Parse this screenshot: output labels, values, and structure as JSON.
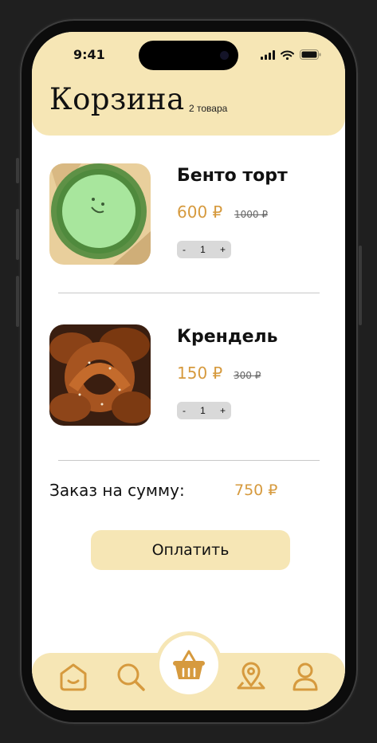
{
  "status_bar": {
    "time": "9:41"
  },
  "header": {
    "title": "Корзина",
    "count": "2 товара"
  },
  "cart": {
    "items": [
      {
        "name": "Бенто торт",
        "price": "600 ₽",
        "old_price": "1000 ₽",
        "quantity": "1",
        "minus": "-",
        "plus": "+"
      },
      {
        "name": "Крендель",
        "price": "150 ₽",
        "old_price": "300 ₽",
        "quantity": "1",
        "minus": "-",
        "plus": "+"
      }
    ]
  },
  "summary": {
    "label": "Заказ на сумму:",
    "total": "750 ₽"
  },
  "pay_button": {
    "label": "Оплатить"
  },
  "tab_bar": {
    "items": [
      {
        "icon": "home-icon",
        "active": false
      },
      {
        "icon": "search-icon",
        "active": false
      },
      {
        "icon": "basket-icon",
        "active": true
      },
      {
        "icon": "map-pin-icon",
        "active": false
      },
      {
        "icon": "profile-icon",
        "active": false
      }
    ]
  },
  "colors": {
    "accent": "#d69a3e",
    "cream": "#f6e6b5",
    "text": "#111111",
    "stepper": "#d9d9d9"
  }
}
